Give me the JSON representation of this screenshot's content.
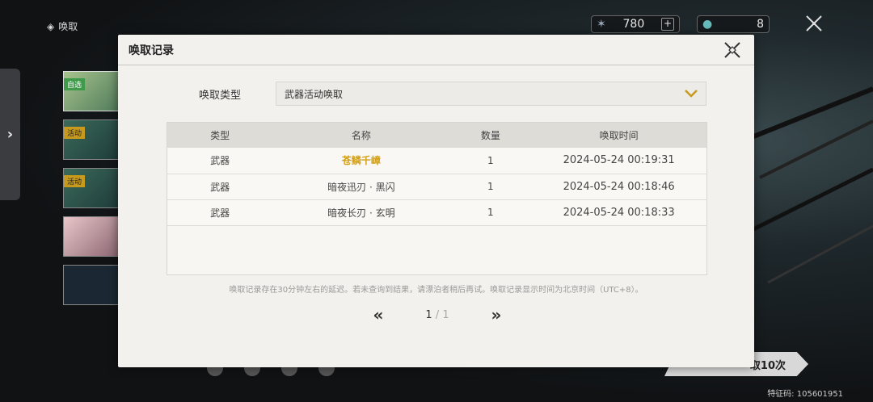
{
  "background_page": {
    "title": "唤取",
    "banner_tags": [
      "自选",
      "活动",
      "活动"
    ],
    "currency1_value": "780",
    "currency2_value": "8",
    "pull_button_label": "取10次",
    "uid_text": "特征码: 105601951"
  },
  "modal": {
    "title": "唤取记录",
    "filter_label": "唤取类型",
    "filter_value": "武器活动唤取",
    "table": {
      "headers": [
        "类型",
        "名称",
        "数量",
        "唤取时间"
      ],
      "rows": [
        {
          "type": "武器",
          "name": "苍鳞千嶂",
          "qty": "1",
          "time": "2024-05-24 00:19:31",
          "highlight": true
        },
        {
          "type": "武器",
          "name": "暗夜迅刃 · 黑闪",
          "qty": "1",
          "time": "2024-05-24 00:18:46",
          "highlight": false
        },
        {
          "type": "武器",
          "name": "暗夜长刃 · 玄明",
          "qty": "1",
          "time": "2024-05-24 00:18:33",
          "highlight": false
        }
      ]
    },
    "note": "唤取记录存在30分钟左右的延迟。若未查询到结果，请漂泊者稍后再试。唤取记录显示时间为北京时间（UTC+8）。",
    "pager": {
      "current": "1",
      "separator": "/",
      "total": "1"
    }
  },
  "colors": {
    "highlight_name": "#d4a017",
    "modal_bg": "#f2f1ee",
    "header_row": "#dedcd7"
  }
}
